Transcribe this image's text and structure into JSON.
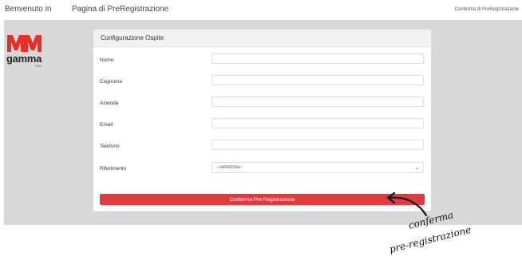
{
  "header": {
    "welcome": "Benvenuto in",
    "page_title": "Pagina di PreRegistrazione",
    "nav_link": "Conferma di PreRegistrazione"
  },
  "logo": {
    "brand": "gamma",
    "sub": "SPA",
    "colors": {
      "mark": "#e4312b"
    }
  },
  "form": {
    "title": "Configurazione Ospite",
    "fields": {
      "nome": {
        "label": "Nome",
        "value": ""
      },
      "cognome": {
        "label": "Cognome",
        "value": ""
      },
      "azienda": {
        "label": "Azienda",
        "value": ""
      },
      "email": {
        "label": "Email",
        "value": ""
      },
      "telefono": {
        "label": "Telefono",
        "value": ""
      }
    },
    "riferimento": {
      "label": "Riferimento",
      "selected": "--seleziona--"
    },
    "submit_label": "Conferma Pre Registrazione"
  },
  "annotation": {
    "line1": "conferma",
    "line2": "pre-registrazione"
  },
  "colors": {
    "accent": "#e03a3c",
    "background": "#d8d8d8"
  }
}
